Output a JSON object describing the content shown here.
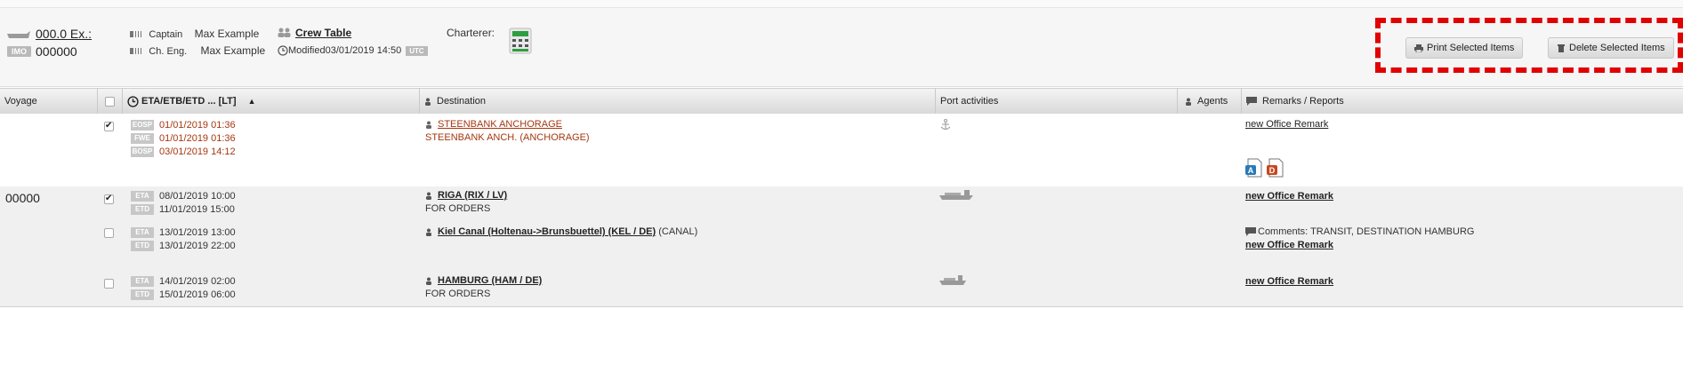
{
  "vessel": {
    "name": "000.0 Ex.:",
    "imo_label": "IMO",
    "imo": "000000"
  },
  "crew": {
    "captain_role": "Captain",
    "captain_name": "Max Example",
    "ch_eng_role": "Ch. Eng.",
    "ch_eng_name": "Max Example",
    "crew_table_label": "Crew Table",
    "modified_label": "Modified",
    "modified_value": "03/01/2019 14:50",
    "timezone_badge": "UTC"
  },
  "charterer_label": "Charterer:",
  "toolbar": {
    "print_label": "Print Selected Items",
    "delete_label": "Delete Selected Items"
  },
  "table": {
    "columns": {
      "voyage": "Voyage",
      "eta": "ETA/ETB/ETD ... [LT]",
      "destination": "Destination",
      "port_activities": "Port activities",
      "agents": "Agents",
      "remarks": "Remarks / Reports"
    },
    "rows": [
      {
        "voyage": "",
        "checked": true,
        "events": [
          {
            "tag": "EOSP",
            "value": "01/01/2019 01:36"
          },
          {
            "tag": "FWE",
            "value": "01/01/2019 01:36"
          },
          {
            "tag": "BOSP",
            "value": "03/01/2019 14:12"
          }
        ],
        "destination": "STEENBANK ANCHORAGE",
        "destination_sub": "STEENBANK ANCH. (ANCHORAGE)",
        "remark": "new Office Remark",
        "icons": [
          "anchor-icon",
          "report-a-icon",
          "report-d-icon"
        ]
      },
      {
        "voyage": "00000",
        "checked": true,
        "events": [
          {
            "tag": "ETA",
            "value": "08/01/2019 10:00"
          },
          {
            "tag": "ETD",
            "value": "11/01/2019 15:00"
          }
        ],
        "destination": "RIGA (RIX / LV)",
        "destination_sub": "FOR ORDERS",
        "remark": "new Office Remark",
        "icons": [
          "cargo-ship-icon"
        ]
      },
      {
        "voyage": "",
        "checked": false,
        "events": [
          {
            "tag": "ETA",
            "value": "13/01/2019 13:00"
          },
          {
            "tag": "ETD",
            "value": "13/01/2019 22:00"
          }
        ],
        "destination": "Kiel Canal (Holtenau->Brunsbuettel) (KEL / DE)",
        "destination_suffix": "(CANAL)",
        "comment": "Comments: TRANSIT, DESTINATION HAMBURG",
        "remark": "new Office Remark"
      },
      {
        "voyage": "",
        "checked": false,
        "events": [
          {
            "tag": "ETA",
            "value": "14/01/2019 02:00"
          },
          {
            "tag": "ETD",
            "value": "15/01/2019 06:00"
          }
        ],
        "destination": "HAMBURG (HAM / DE)",
        "destination_sub": "FOR ORDERS",
        "remark": "new Office Remark",
        "icons": [
          "cargo-ship-icon"
        ]
      }
    ]
  },
  "colors": {
    "annotation_red": "#e10000",
    "eosp_text": "#a6370f"
  }
}
